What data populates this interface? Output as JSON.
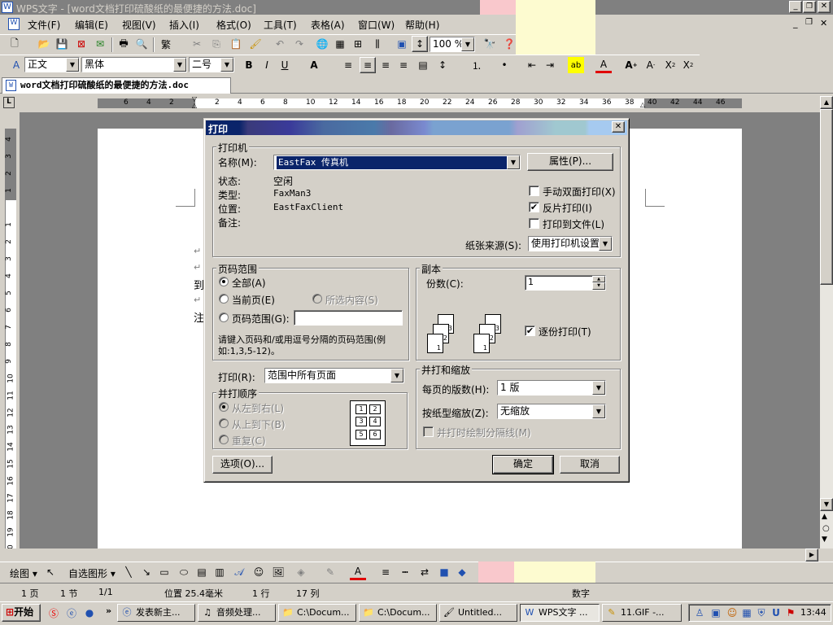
{
  "window": {
    "title": "WPS文字 - [word文档打印硫酸纸的最便捷的方法.doc]"
  },
  "menu": [
    "文件(F)",
    "编辑(E)",
    "视图(V)",
    "插入(I)",
    "格式(O)",
    "工具(T)",
    "表格(A)",
    "窗口(W)",
    "帮助(H)"
  ],
  "toolbar": {
    "zoom": "100 %",
    "traditional": "繁"
  },
  "format_bar": {
    "style": "正文",
    "font": "黑体",
    "size": "二号"
  },
  "doc_tab": {
    "label": "word文档打印硫酸纸的最便捷的方法.doc"
  },
  "ruler": {
    "ticks": [
      "6",
      "4",
      "2",
      "2",
      "4",
      "6",
      "8",
      "10",
      "12",
      "14",
      "16",
      "18",
      "20",
      "22",
      "24",
      "26",
      "28",
      "30",
      "32",
      "34",
      "36",
      "38",
      "40",
      "42",
      "44",
      "46"
    ]
  },
  "document": {
    "lines": [
      "↵",
      "↵",
      "到",
      "↵",
      "注"
    ]
  },
  "dialog": {
    "title": "打印",
    "printer": {
      "group": "打印机",
      "name_label": "名称(M):",
      "name_value": "EastFax 传真机",
      "properties_button": "属性(P)...",
      "status_label": "状态:",
      "status_value": "空闲",
      "type_label": "类型:",
      "type_value": "FaxMan3",
      "location_label": "位置:",
      "location_value": "EastFaxClient",
      "comment_label": "备注:",
      "duplex_manual": "手动双面打印(X)",
      "reverse_print": "反片打印(I)",
      "print_to_file": "打印到文件(L)",
      "paper_source_label": "纸张来源(S):",
      "paper_source_value": "使用打印机设置"
    },
    "page_range": {
      "group": "页码范围",
      "all": "全部(A)",
      "current": "当前页(E)",
      "selection": "所选内容(S)",
      "pages": "页码范围(G):",
      "hint": "请键入页码和/或用逗号分隔的页码范围(例如:1,3,5-12)。"
    },
    "copies": {
      "group": "副本",
      "count_label": "份数(C):",
      "count_value": "1",
      "collate": "逐份打印(T)"
    },
    "print_what": {
      "label": "打印(R):",
      "value": "范围中所有页面"
    },
    "order": {
      "group": "并打顺序",
      "ltr": "从左到右(L)",
      "ttb": "从上到下(B)",
      "repeat": "重复(C)"
    },
    "zoom": {
      "group": "并打和缩放",
      "pages_per_sheet_label": "每页的版数(H):",
      "pages_per_sheet_value": "1 版",
      "scale_label": "按纸型缩放(Z):",
      "scale_value": "无缩放",
      "draw_borders": "并打时绘制分隔线(M)"
    },
    "options_button": "选项(O)...",
    "ok_button": "确定",
    "cancel_button": "取消"
  },
  "drawing_bar": {
    "draw": "绘图",
    "autoshapes": "自选图形"
  },
  "status_bar": {
    "page": "1 页",
    "section": "1 节",
    "pages": "1/1",
    "position": "位置 25.4毫米",
    "line": "1 行",
    "col": "17 列",
    "mode": "数字"
  },
  "taskbar": {
    "start": "开始",
    "tasks": [
      "发表新主...",
      "音频处理...",
      "C:\\Docum...",
      "C:\\Docum...",
      "Untitled...",
      "WPS文字 ...",
      "11.GIF -..."
    ],
    "clock": "13:44"
  }
}
